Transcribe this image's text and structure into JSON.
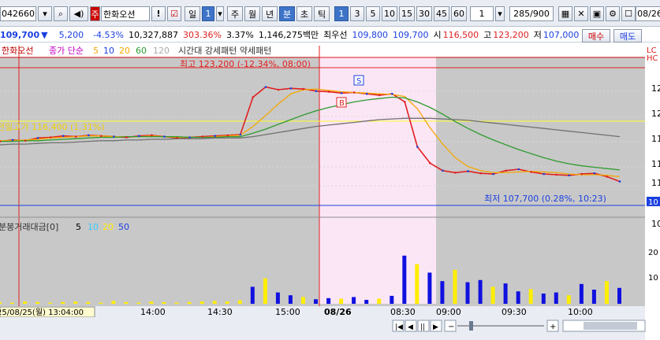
{
  "toolbar": {
    "code": "042660",
    "name": "한화오션",
    "badge": "주",
    "period_active": "일",
    "period_num": "1",
    "periods": [
      "주",
      "월",
      "년"
    ],
    "minute": "분",
    "tick": "초",
    "tick2": "틱",
    "intervals": [
      "1",
      "3",
      "5",
      "10",
      "15",
      "30",
      "45",
      "60"
    ],
    "count": "1",
    "range": "285/900",
    "date": "08/26"
  },
  "quote": {
    "price": "109,700",
    "change": "5,200",
    "rate": "-4.53%",
    "volume": "10,327,887",
    "vol_ratio": "303.36%",
    "turnover": "3.37%",
    "amount": "1,146,275백만",
    "best_ask_label": "최우선",
    "best_bid": "109,800",
    "best_ask": "109,700",
    "open_label": "시",
    "open": "116,500",
    "high_label": "고",
    "high": "123,200",
    "low_label": "저",
    "low": "107,000",
    "buy_label": "매수",
    "sell_label": "매도"
  },
  "legend": {
    "name": "한화오선",
    "indicator": "종가 단순",
    "ma": [
      "5",
      "10",
      "20",
      "60",
      "120"
    ],
    "extra": "시간대 강세패턴 약세패턴"
  },
  "annotations": {
    "high": "최고 123,200 (-12.34%, 08:00)",
    "prev_high": "전일고가 116,400 (1.31%)",
    "low": "최저 107,700 (0.28%, 10:23)",
    "marker_b": "B",
    "marker_s": "S"
  },
  "volume_legend": {
    "title": "분봉거래대금[0]",
    "ma": [
      "5",
      "10",
      "20",
      "50"
    ]
  },
  "x_axis": {
    "labels": [
      "14:00",
      "14:30",
      "15:00",
      "08/26",
      "08:30",
      "09:00",
      "09:30",
      "10:00"
    ],
    "cursor": "25/08/25(월) 13:04:00"
  },
  "y_axis": {
    "labels": [
      "12",
      "12",
      "11",
      "11",
      "11",
      "10"
    ],
    "vol_labels": [
      "20",
      "10"
    ],
    "top_labels": [
      "LC",
      "HC"
    ]
  },
  "colors": {
    "price_red": "#e02020",
    "price_blue": "#1a3fe0",
    "ma5": "#f5a800",
    "ma20": "#2e9b2e",
    "ma60": "#707070",
    "highlight": "#fbe6f6",
    "grid": "#d0d0d0",
    "volume_yellow": "#ffee00"
  },
  "chart_data": {
    "type": "line",
    "title": "",
    "xlabel": "",
    "ylabel": "",
    "ylim": [
      104000,
      126000
    ],
    "series": [
      {
        "name": "종가",
        "values": [
          114000,
          114200,
          114100,
          114500,
          114600,
          114800,
          114700,
          114900,
          114800,
          114700,
          114600,
          114800,
          114900,
          114700,
          114500,
          114600,
          114700,
          114800,
          114900,
          115000,
          120500,
          122000,
          121600,
          121800,
          121700,
          121400,
          121300,
          121100,
          121200,
          121000,
          120800,
          121000,
          119800,
          113200,
          110800,
          109700,
          109400,
          109600,
          109300,
          109200,
          109700,
          109900,
          109500,
          109200,
          109100,
          109000,
          109200,
          109300,
          108800,
          108100
        ]
      },
      {
        "name": "5",
        "values": [
          114100,
          114100,
          114200,
          114300,
          114500,
          114600,
          114700,
          114800,
          114800,
          114700,
          114700,
          114700,
          114800,
          114700,
          114600,
          114600,
          114600,
          114700,
          114800,
          114900,
          116200,
          117800,
          119500,
          121000,
          121600,
          121700,
          121500,
          121300,
          121200,
          121100,
          121000,
          120900,
          120600,
          118800,
          116000,
          113600,
          111600,
          110300,
          109700,
          109400,
          109400,
          109500,
          109600,
          109500,
          109400,
          109200,
          109100,
          109100,
          109000,
          108800
        ]
      },
      {
        "name": "20",
        "values": [
          114000,
          114000,
          114100,
          114100,
          114200,
          114300,
          114400,
          114500,
          114600,
          114600,
          114700,
          114700,
          114700,
          114700,
          114700,
          114600,
          114600,
          114600,
          114700,
          114700,
          115200,
          115800,
          116500,
          117200,
          117900,
          118500,
          119000,
          119400,
          119800,
          120100,
          120300,
          120500,
          120400,
          119800,
          119000,
          118000,
          116900,
          115900,
          115000,
          114200,
          113500,
          112800,
          112200,
          111600,
          111100,
          110700,
          110400,
          110200,
          110000,
          109800
        ]
      },
      {
        "name": "60",
        "values": [
          113500,
          113600,
          113600,
          113700,
          113800,
          113800,
          113900,
          114000,
          114100,
          114100,
          114200,
          114200,
          114300,
          114300,
          114400,
          114400,
          114400,
          114500,
          114500,
          114500,
          114700,
          115000,
          115300,
          115600,
          115900,
          116200,
          116400,
          116600,
          116800,
          117000,
          117200,
          117300,
          117400,
          117400,
          117400,
          117300,
          117200,
          117100,
          116900,
          116700,
          116500,
          116300,
          116100,
          115900,
          115700,
          115500,
          115300,
          115100,
          114900,
          114700
        ]
      }
    ]
  }
}
